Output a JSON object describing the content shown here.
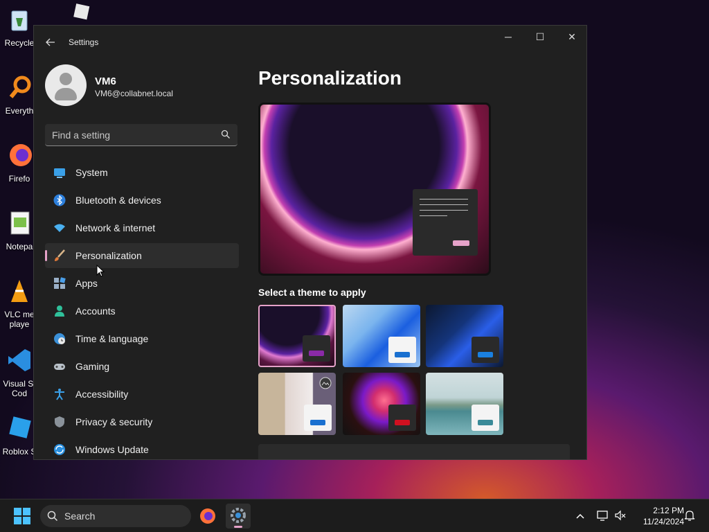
{
  "desktop": {
    "icons": [
      {
        "label": "Recycle"
      },
      {
        "label": "Everyth"
      },
      {
        "label": "Firefo"
      },
      {
        "label": "Notepa"
      },
      {
        "label": "VLC me"
      },
      {
        "label": "playe"
      },
      {
        "label": "Visual St"
      },
      {
        "label": "Cod"
      },
      {
        "label": "Roblox S"
      }
    ]
  },
  "window": {
    "title": "Settings",
    "controls": {
      "minimize": "─",
      "maximize": "☐",
      "close": "✕"
    }
  },
  "profile": {
    "name": "VM6",
    "email": "VM6@collabnet.local"
  },
  "search": {
    "placeholder": "Find a setting"
  },
  "nav": {
    "items": [
      {
        "label": "System",
        "icon": "system-icon"
      },
      {
        "label": "Bluetooth & devices",
        "icon": "bluetooth-icon"
      },
      {
        "label": "Network & internet",
        "icon": "wifi-icon"
      },
      {
        "label": "Personalization",
        "icon": "brush-icon",
        "active": true
      },
      {
        "label": "Apps",
        "icon": "apps-icon"
      },
      {
        "label": "Accounts",
        "icon": "accounts-icon"
      },
      {
        "label": "Time & language",
        "icon": "globe-clock-icon"
      },
      {
        "label": "Gaming",
        "icon": "gamepad-icon"
      },
      {
        "label": "Accessibility",
        "icon": "accessibility-icon"
      },
      {
        "label": "Privacy & security",
        "icon": "shield-icon"
      },
      {
        "label": "Windows Update",
        "icon": "update-icon"
      }
    ]
  },
  "main": {
    "title": "Personalization",
    "theme_heading": "Select a theme to apply"
  },
  "colors": {
    "accent": "#e6a2c9",
    "window_bg": "#202020",
    "nav_active_bg": "#2d2d2d"
  },
  "taskbar": {
    "search_label": "Search",
    "time": "2:12 PM",
    "date": "11/24/2024"
  }
}
